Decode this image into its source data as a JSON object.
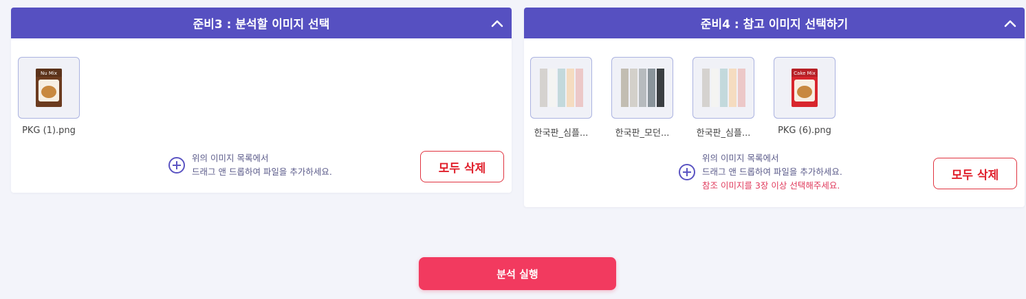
{
  "panel3": {
    "title": "준비3 : 분석할 이미지 선택",
    "images": [
      {
        "name": "PKG (1).png",
        "kind": "product",
        "label": "Nu Mix",
        "box_color": "#6b3b1f"
      }
    ],
    "drop_hint_line1": "위의 이미지 목록에서",
    "drop_hint_line2": "드래그 앤 드롭하여 파일을 추가하세요.",
    "clear_label": "모두 삭제"
  },
  "panel4": {
    "title": "준비4 : 참고 이미지 선택하기",
    "images": [
      {
        "name": "한국판_심플...",
        "kind": "palette",
        "colors": [
          "#d5d2cf",
          "#f4f4f2",
          "#c3d9dc",
          "#f5dcc0",
          "#ecc8c8"
        ]
      },
      {
        "name": "한국판_모던...",
        "kind": "palette",
        "colors": [
          "#c2bdb2",
          "#d3d0ca",
          "#b7bbbe",
          "#8a949b",
          "#3b3f42"
        ]
      },
      {
        "name": "한국판_심플...",
        "kind": "palette",
        "colors": [
          "#d5d2cf",
          "#f4f4f2",
          "#c3d9dc",
          "#f5dcc0",
          "#ecc8c8"
        ]
      },
      {
        "name": "PKG (6).png",
        "kind": "product",
        "label": "Cake Mix",
        "box_color": "#d8262d"
      }
    ],
    "drop_hint_line1": "위의 이미지 목록에서",
    "drop_hint_line2": "드래그 앤 드롭하여 파일을 추가하세요.",
    "warning": "참조 이미지를 3장 이상 선택해주세요.",
    "clear_label": "모두 삭제"
  },
  "run_button_label": "분석 실행",
  "icons": {
    "collapse": "chevron-up-icon",
    "add": "plus-circle-icon"
  },
  "colors": {
    "header": "#5650c1",
    "accent": "#f23a5f",
    "danger": "#e01e2a"
  }
}
